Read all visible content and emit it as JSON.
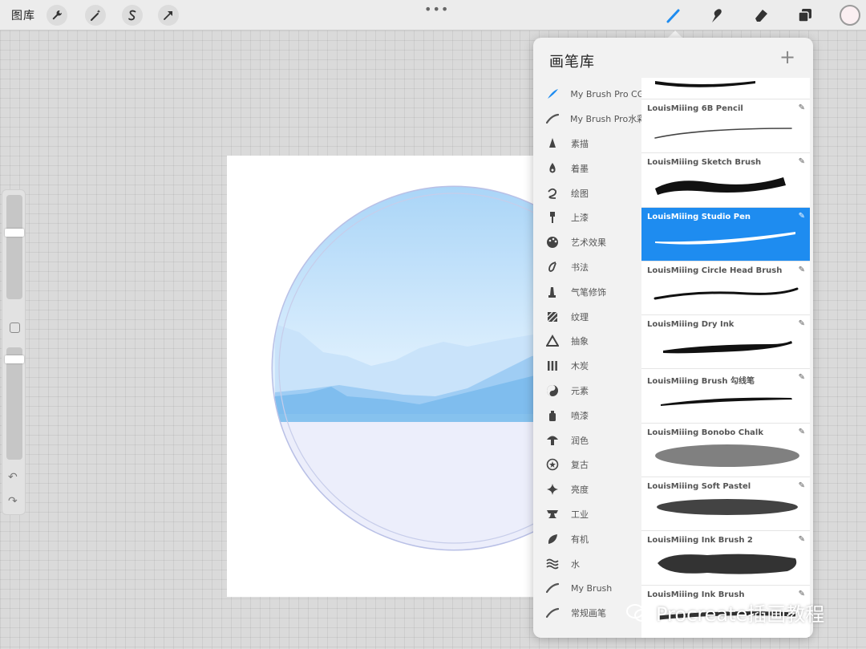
{
  "topbar": {
    "gallery_label": "图库",
    "more_dots": "•••",
    "tools": [
      {
        "name": "actions-wrench-icon"
      },
      {
        "name": "adjustments-wand-icon"
      },
      {
        "name": "selection-s-icon"
      },
      {
        "name": "transform-arrow-icon"
      }
    ],
    "right_tools": [
      "brush-icon",
      "smudge-icon",
      "eraser-icon",
      "layers-icon"
    ],
    "current_color": "#fbeff2"
  },
  "sidebar": {
    "undo_label": "↶",
    "redo_label": "↷"
  },
  "panel": {
    "title": "画笔库",
    "add_label": "+",
    "categories": [
      {
        "label": "My Brush Pro CG",
        "icon": "feather-icon"
      },
      {
        "label": "My Brush Pro水彩",
        "icon": "stroke-icon"
      },
      {
        "label": "素描",
        "icon": "pencil-tip-icon"
      },
      {
        "label": "着墨",
        "icon": "ink-drop-icon"
      },
      {
        "label": "绘图",
        "icon": "curl-icon"
      },
      {
        "label": "上漆",
        "icon": "paint-brush-icon"
      },
      {
        "label": "艺术效果",
        "icon": "palette-icon"
      },
      {
        "label": "书法",
        "icon": "calligraphy-icon"
      },
      {
        "label": "气笔修饰",
        "icon": "airbrush-icon"
      },
      {
        "label": "纹理",
        "icon": "texture-icon"
      },
      {
        "label": "抽象",
        "icon": "triangle-icon"
      },
      {
        "label": "木炭",
        "icon": "charcoal-icon"
      },
      {
        "label": "元素",
        "icon": "yin-yang-icon"
      },
      {
        "label": "喷漆",
        "icon": "spray-can-icon"
      },
      {
        "label": "润色",
        "icon": "mushroom-icon"
      },
      {
        "label": "复古",
        "icon": "star-circle-icon"
      },
      {
        "label": "亮度",
        "icon": "sparkle-icon"
      },
      {
        "label": "工业",
        "icon": "anvil-icon"
      },
      {
        "label": "有机",
        "icon": "leaf-icon"
      },
      {
        "label": "水",
        "icon": "waves-icon"
      },
      {
        "label": "My Brush",
        "icon": "stroke-icon"
      },
      {
        "label": "常规画笔",
        "icon": "stroke-icon"
      }
    ],
    "brushes": [
      {
        "name": "LouisMiiing 6B Pencil",
        "selected": false,
        "stroke": "pencil"
      },
      {
        "name": "LouisMiiing Sketch Brush",
        "selected": false,
        "stroke": "sketch"
      },
      {
        "name": "LouisMiiing Studio Pen",
        "selected": true,
        "stroke": "studio"
      },
      {
        "name": "LouisMiiing Circle Head Brush",
        "selected": false,
        "stroke": "circle"
      },
      {
        "name": "LouisMiiing Dry Ink",
        "selected": false,
        "stroke": "dry"
      },
      {
        "name": "LouisMiiing Brush 勾线笔",
        "selected": false,
        "stroke": "line"
      },
      {
        "name": "LouisMiiing Bonobo Chalk",
        "selected": false,
        "stroke": "chalk"
      },
      {
        "name": "LouisMiiing Soft Pastel",
        "selected": false,
        "stroke": "pastel"
      },
      {
        "name": "LouisMiiing Ink Brush 2",
        "selected": false,
        "stroke": "ink2"
      },
      {
        "name": "LouisMiiing Ink Brush",
        "selected": false,
        "stroke": "ink"
      }
    ],
    "edit_icon": "✎"
  },
  "watermark": {
    "text": "Procreate插画教程"
  },
  "colors": {
    "accent": "#1e8cf0",
    "sky": "#a9d3f5",
    "mountain": "#6fb6ea"
  }
}
